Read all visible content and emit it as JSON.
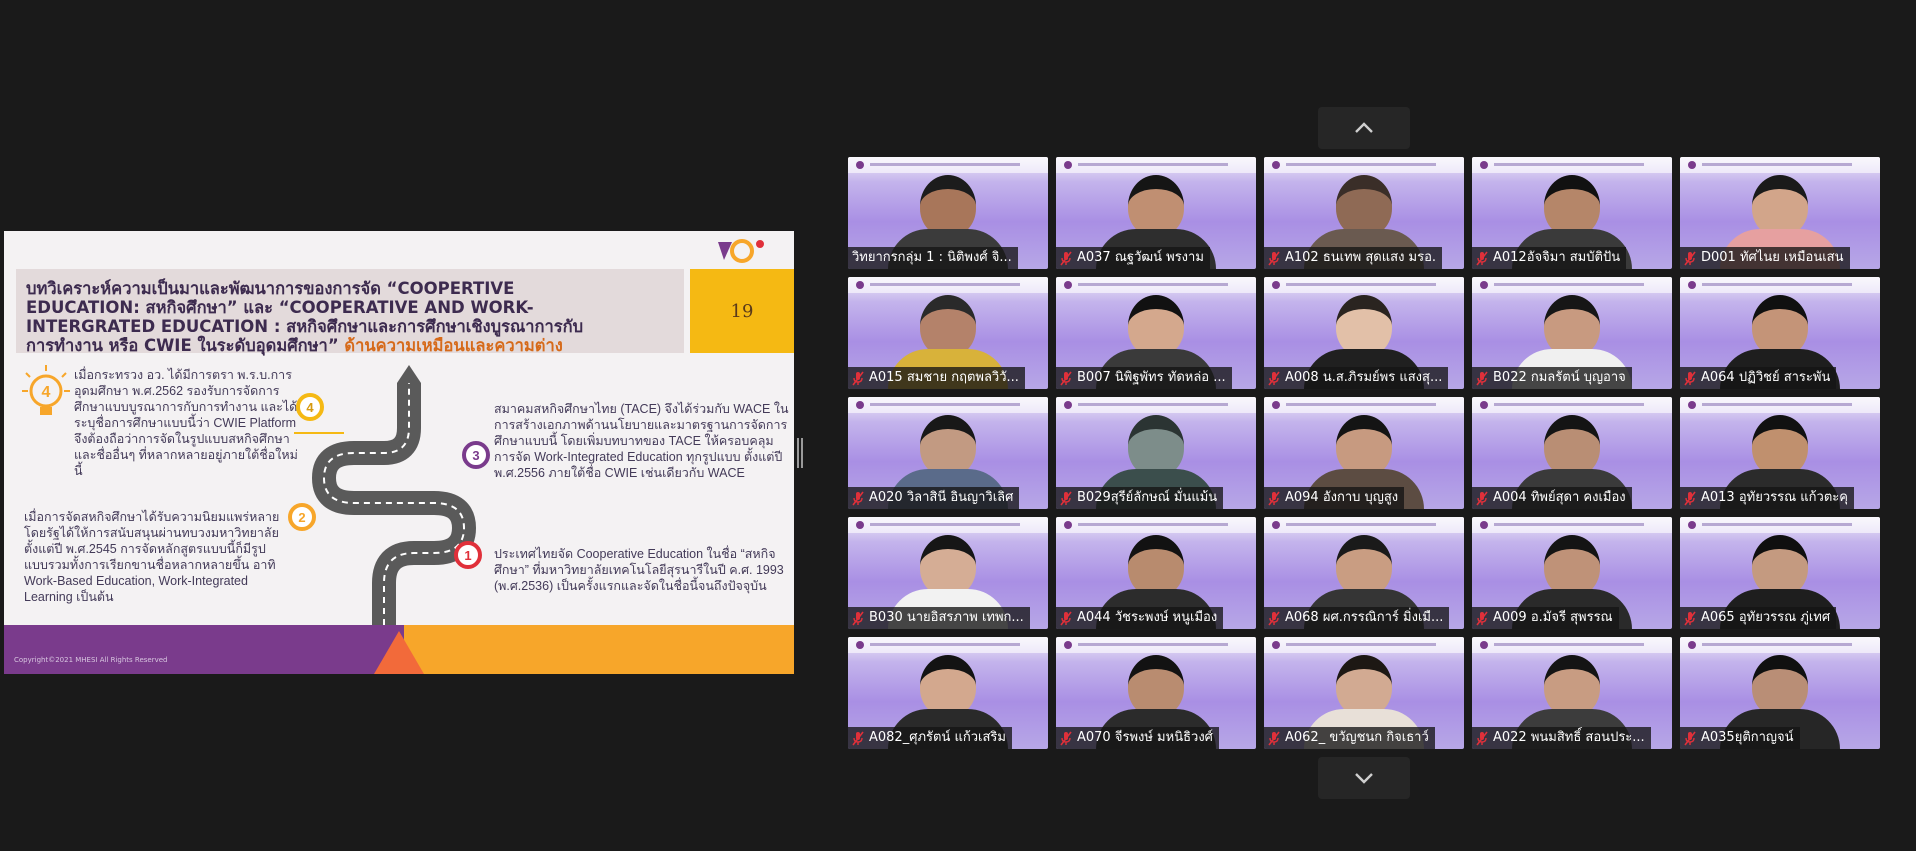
{
  "slide": {
    "title_line1": "บทวิเคราะห์ความเป็นมาและพัฒนาการของการจัด “COOPERTIVE",
    "title_line2": "EDUCATION: สหกิจศึกษา” และ “COOPERATIVE AND WORK-",
    "title_line3": "INTERGRATED EDUCATION : สหกิจศึกษาและการศึกษาเชิงบูรณาการกับ",
    "title_line4": "การทำงาน หรือ CWIE ในระดับอุดมศึกษา”",
    "title_highlight": "ด้านความเหมือนและความต่าง",
    "page_number": "19",
    "text_left_top": "เมื่อกระทรวง อว. ได้มีการตรา พ.ร.บ.การอุดมศึกษา พ.ศ.2562 รองรับการจัดการศึกษาแบบบูรณาการกับการทำงาน และได้ระบุชื่อการศึกษาแบบนี้ว่า CWIE Platform จึงต้องถือว่าการจัดในรูปแบบสหกิจศึกษาและชื่ออื่นๆ ที่หลากหลายอยู่ภายใต้ชื่อใหม่นี้",
    "text_left_bottom": "เมื่อการจัดสหกิจศึกษาได้รับความนิยมแพร่หลายโดยรัฐได้ให้การสนับสนุนผ่านทบวงมหาวิทยาลัย ตั้งแต่ปี พ.ศ.2545 การจัดหลักสูตรแบบนี้ก็มีรูปแบบรวมทั้งการเรียกขานชื่อหลากหลายขึ้น อาทิ Work-Based Education, Work-Integrated Learning เป็นต้น",
    "text_right_top": "สมาคมสหกิจศึกษาไทย (TACE) จึงได้ร่วมกับ WACE ในการสร้างเอกภาพด้านนโยบายและมาตรฐานการจัดการศึกษาแบบนี้ โดยเพิ่มบทบาทของ TACE ให้ครอบคลุมการจัด Work-Integrated Education ทุกรูปแบบ ตั้งแต่ปี พ.ศ.2556 ภายใต้ชื่อ CWIE เช่นเดียวกับ WACE",
    "text_right_bottom": "ประเทศไทยจัด Cooperative Education ในชื่อ “สหกิจศึกษา” ที่มหาวิทยาลัยเทคโนโลยีสุรนารีในปี ค.ศ. 1993 (พ.ศ.2536) เป็นครั้งแรกและจัดในชื่อนี้จนถึงปัจจุบัน",
    "steps": [
      "1",
      "2",
      "3",
      "4"
    ],
    "big_number": "4",
    "copyright": "Copyright©2021 MHESI All Rights Reserved"
  },
  "colors": {
    "purple": "#7a3b8c",
    "orange": "#f7a62a",
    "yellow": "#f5b913",
    "title_text": "#3d2b4f",
    "highlight": "#d66a1a",
    "mic_muted": "#e0303a"
  },
  "gallery": {
    "tiles": [
      {
        "name": "วิทยากรกลุ่ม 1 : นิติพงศ์ จิ...",
        "muted": false,
        "skin": "#a8765a",
        "shirt": "#3b3b3b",
        "hair": "#1c1c1c"
      },
      {
        "name": "A037 ณฐวัฒน์ พรงาม",
        "muted": true,
        "skin": "#c08f72",
        "shirt": "#2e2e2e",
        "hair": "#151515"
      },
      {
        "name": "A102 ธนเทพ  สุดแสง มรอ.",
        "muted": true,
        "skin": "#8f6a55",
        "shirt": "#6a5a50",
        "hair": "#3a2e28"
      },
      {
        "name": "A012อัจจิมา สมบัติปัน",
        "muted": true,
        "skin": "#b58669",
        "shirt": "#3a3a3a",
        "hair": "#111111"
      },
      {
        "name": "D001 ทัศไนย เหมือนเสน",
        "muted": true,
        "skin": "#d2a58a",
        "shirt": "#e6a0a0",
        "hair": "#1a1a1a"
      },
      {
        "name": "A015 สมชาย กฤตพลวิวั...",
        "muted": true,
        "skin": "#b4826a",
        "shirt": "#d8b23a",
        "hair": "#2a2a2a"
      },
      {
        "name": "B007 นิพิฐพัทร ทัดหล่อ ...",
        "muted": true,
        "skin": "#d4a88d",
        "shirt": "#3a3a3a",
        "hair": "#111111"
      },
      {
        "name": "A008 น.ส.ภิรมย์พร แสงสุ...",
        "muted": true,
        "skin": "#e2c0a8",
        "shirt": "#202020",
        "hair": "#2a2420"
      },
      {
        "name": "B022 กมลรัตน์ บุญอาจ",
        "muted": true,
        "skin": "#c89a80",
        "shirt": "#f0f0f0",
        "hair": "#161616"
      },
      {
        "name": "A064 ปฏิวิชย์ สาระพัน",
        "muted": true,
        "skin": "#c49478",
        "shirt": "#1e1e1e",
        "hair": "#101010"
      },
      {
        "name": "A020 วิลาสินี อินญาวิเลิศ",
        "muted": true,
        "skin": "#c29a82",
        "shirt": "#5a6b8a",
        "hair": "#181818"
      },
      {
        "name": "B029สุรีย์ลักษณ์ มั่นแม้น",
        "muted": true,
        "skin": "#7d8d8a",
        "shirt": "#3b4e4c",
        "hair": "#2b3433"
      },
      {
        "name": "A094 อังกาบ บุญสูง",
        "muted": true,
        "skin": "#c79a80",
        "shirt": "#5c4c42",
        "hair": "#141414"
      },
      {
        "name": "A004 ทิพย์สุดา คงเมือง",
        "muted": true,
        "skin": "#b98e74",
        "shirt": "#3a3a3a",
        "hair": "#141414"
      },
      {
        "name": "A013 อุทัยวรรณ แก้วตะคุ",
        "muted": true,
        "skin": "#c0906e",
        "shirt": "#2b2b2b",
        "hair": "#111111"
      },
      {
        "name": "B030 นายอิสรภาพ  เทพก...",
        "muted": true,
        "skin": "#d5ad95",
        "shirt": "#f2f2f2",
        "hair": "#161616"
      },
      {
        "name": "A044 วัชระพงษ์ หนูเมือง",
        "muted": true,
        "skin": "#b88b6e",
        "shirt": "#2c2c2c",
        "hair": "#121212"
      },
      {
        "name": "A068 ผศ.กรรณิการ์ มิ่งเมื...",
        "muted": true,
        "skin": "#c99d82",
        "shirt": "#353535",
        "hair": "#1a1a1a"
      },
      {
        "name": "A009 อ.มัจรี สุพรรณ",
        "muted": true,
        "skin": "#bf9278",
        "shirt": "#2a2a2a",
        "hair": "#141414"
      },
      {
        "name": "A065 อุทัยวรรณ ภู่เทศ",
        "muted": true,
        "skin": "#c49a80",
        "shirt": "#1e1e1e",
        "hair": "#0f0f0f"
      },
      {
        "name": "A082_ศุภรัตน์ แก้วเสริม",
        "muted": true,
        "skin": "#d3a88e",
        "shirt": "#2a2a2a",
        "hair": "#131313"
      },
      {
        "name": "A070 จีรพงษ์ มหนิธิวงศ์",
        "muted": true,
        "skin": "#b98c70",
        "shirt": "#2b2b2b",
        "hair": "#121212"
      },
      {
        "name": "A062_ ขวัญชนก กิจเธาว์",
        "muted": true,
        "skin": "#d2aa92",
        "shirt": "#e8e0d8",
        "hair": "#1d1814"
      },
      {
        "name": "A022 พนมสิทธิ์  สอนประ...",
        "muted": true,
        "skin": "#c89c82",
        "shirt": "#3c3c3c",
        "hair": "#141414"
      },
      {
        "name": "A035ยุติกาญจน์",
        "muted": true,
        "skin": "#b98e76",
        "shirt": "#262626",
        "hair": "#101010"
      }
    ]
  }
}
